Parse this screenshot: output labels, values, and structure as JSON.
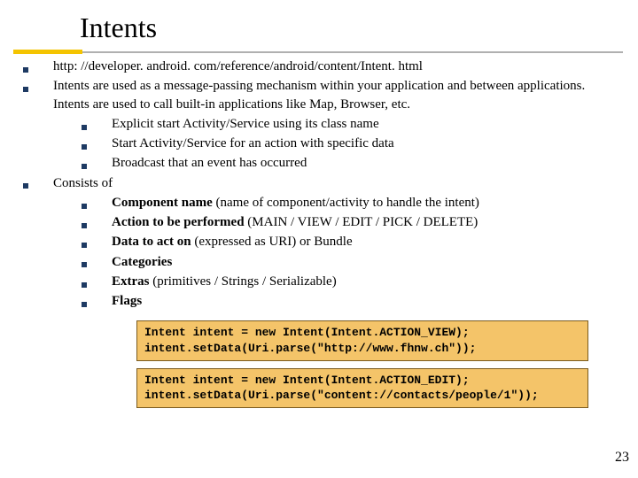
{
  "title": "Intents",
  "bullets": [
    {
      "text": "http: //developer. android. com/reference/android/content/Intent. html",
      "children": []
    },
    {
      "text": "Intents are used as a message-passing mechanism within your application and between applications. Intents are used to call built-in applications like Map, Browser, etc.",
      "children": [
        "Explicit start Activity/Service using its class name",
        "Start Activity/Service for an action with specific data",
        "Broadcast that an event has occurred"
      ]
    },
    {
      "text": "Consists of",
      "children_rich": [
        {
          "bold": "Component name",
          "rest": "  (name of component/activity to handle the intent)"
        },
        {
          "bold": "Action to be performed",
          "rest": "  (MAIN / VIEW / EDIT / PICK / DELETE)"
        },
        {
          "bold": "Data to act on",
          "rest": "  (expressed as URI) or Bundle"
        },
        {
          "bold": "Categories",
          "rest": ""
        },
        {
          "bold": "Extras ",
          "rest": "(primitives / Strings / Serializable)"
        },
        {
          "bold": "Flags",
          "rest": ""
        }
      ]
    }
  ],
  "code": {
    "block1_l1": "Intent intent = new Intent(Intent.ACTION_VIEW);",
    "block1_l2": "intent.setData(Uri.parse(\"http://www.fhnw.ch\"));",
    "block2_l1": "Intent intent = new Intent(Intent.ACTION_EDIT);",
    "block2_l2": "intent.setData(Uri.parse(\"content://contacts/people/1\"));"
  },
  "page_number": "23"
}
